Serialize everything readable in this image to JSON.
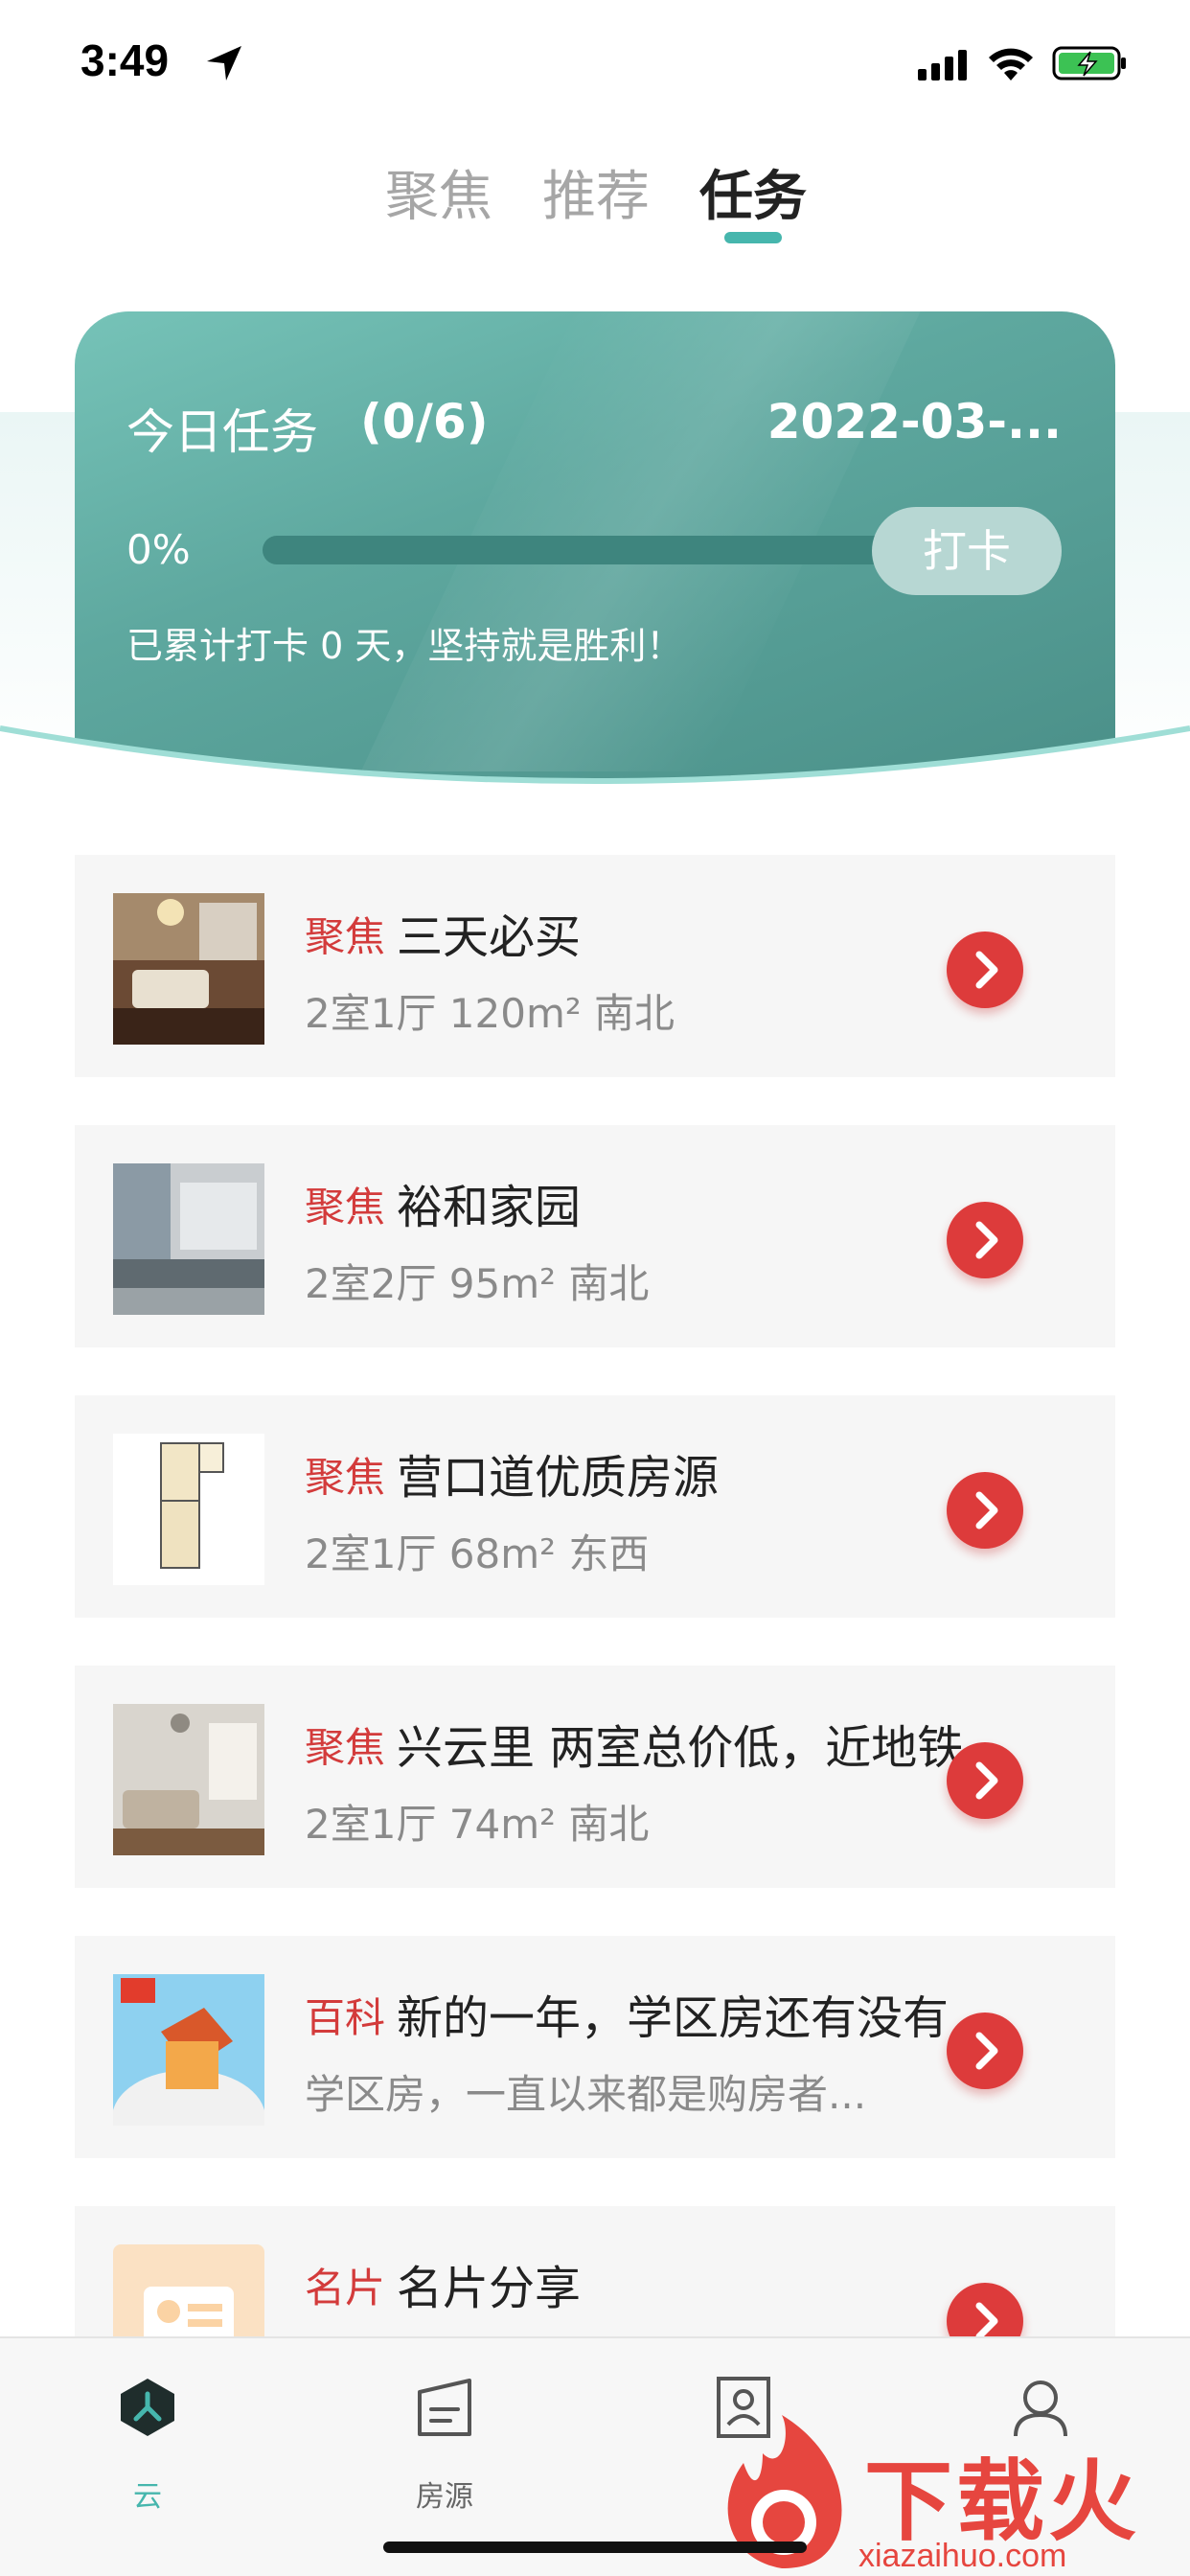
{
  "status_bar": {
    "time": "3:49"
  },
  "top_tabs": {
    "tabs": [
      "聚焦",
      "推荐",
      "任务"
    ],
    "active_index": 2
  },
  "task_card": {
    "title": "今日任务",
    "count": "(0/6)",
    "date": "2022-03-...",
    "percent": "0%",
    "progress": 0,
    "checkin_label": "打卡",
    "note": "已累计打卡 0 天，坚持就是胜利！"
  },
  "items": [
    {
      "tag": "聚焦",
      "title": "三天必买",
      "sub": "2室1厅 120m² 南北",
      "thumb": "living-room-photo"
    },
    {
      "tag": "聚焦",
      "title": "裕和家园",
      "sub": "2室2厅 95m² 南北",
      "thumb": "kitchen-photo"
    },
    {
      "tag": "聚焦",
      "title": "营口道优质房源",
      "sub": "2室1厅 68m² 东西",
      "thumb": "floor-plan-image"
    },
    {
      "tag": "聚焦",
      "title": "兴云里 两室总价低，近地铁",
      "sub": "2室1厅 74m² 南北",
      "thumb": "living-room-photo"
    },
    {
      "tag": "百科",
      "title": "新的一年，学区房还有没有",
      "sub": "学区房，一直以来都是购房者...",
      "thumb": "school-house-illustration"
    },
    {
      "tag": "名片",
      "title": "名片分享",
      "sub": "",
      "thumb": "business-card-icon"
    }
  ],
  "bottom_nav": [
    {
      "label": "云",
      "icon": "cloud-hex-icon",
      "active": true
    },
    {
      "label": "房源",
      "icon": "building-icon",
      "active": false
    },
    {
      "label": "",
      "icon": "contact-card-icon",
      "active": false
    },
    {
      "label": "",
      "icon": "user-icon",
      "active": false
    }
  ],
  "watermark": {
    "text": "下载火",
    "url": "xiazaihuo.com"
  },
  "colors": {
    "accent": "#46b6ad",
    "tag_red": "#d33b3b",
    "arrow_red": "#dd3b3b",
    "card_teal": "#5ea89f"
  }
}
